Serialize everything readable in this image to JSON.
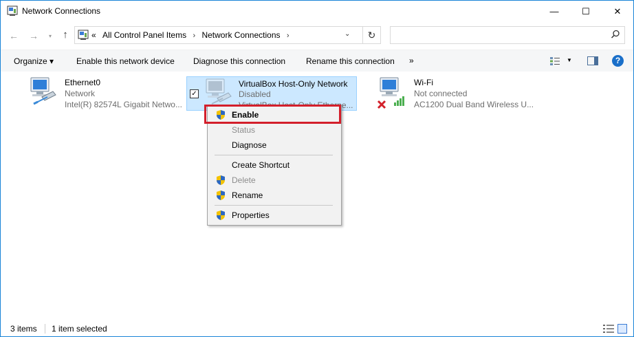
{
  "window": {
    "title": "Network Connections",
    "minimize_glyph": "—",
    "maximize_glyph": "☐",
    "close_glyph": "✕"
  },
  "nav": {
    "back_glyph": "←",
    "forward_glyph": "→",
    "recent_glyph": "▾",
    "up_glyph": "↑",
    "address_prefix": "«",
    "breadcrumbs": [
      "All Control Panel Items",
      "Network Connections"
    ],
    "crumb_sep": "›",
    "dropdown_glyph": "⌄",
    "refresh_glyph": "↻",
    "search_placeholder": ""
  },
  "commands": {
    "organize": "Organize ▾",
    "enable": "Enable this network device",
    "diagnose": "Diagnose this connection",
    "rename": "Rename this connection",
    "more": "»",
    "view_drop": "▼",
    "help": "?"
  },
  "connections": [
    {
      "name": "Ethernet0",
      "status": "Network",
      "device": "Intel(R) 82574L Gigabit Netwo..."
    },
    {
      "name": "VirtualBox Host-Only Network",
      "status": "Disabled",
      "device": "VirtualBox Host-Only Etherne..."
    },
    {
      "name": "Wi-Fi",
      "status": "Not connected",
      "device": "AC1200  Dual Band Wireless U..."
    }
  ],
  "context_menu": {
    "items": [
      {
        "label": "Enable",
        "shield": true,
        "disabled": false,
        "bold": true
      },
      {
        "label": "Status",
        "shield": false,
        "disabled": true,
        "bold": false
      },
      {
        "label": "Diagnose",
        "shield": false,
        "disabled": false,
        "bold": false
      },
      {
        "label": "Create Shortcut",
        "shield": false,
        "disabled": false,
        "bold": false
      },
      {
        "label": "Delete",
        "shield": true,
        "disabled": true,
        "bold": false
      },
      {
        "label": "Rename",
        "shield": true,
        "disabled": false,
        "bold": false
      },
      {
        "label": "Properties",
        "shield": true,
        "disabled": false,
        "bold": false
      }
    ]
  },
  "status": {
    "item_count": "3 items",
    "selected": "1 item selected"
  },
  "colors": {
    "accent": "#1883d7",
    "selection": "#cce8ff",
    "highlight": "#d31f2b"
  }
}
